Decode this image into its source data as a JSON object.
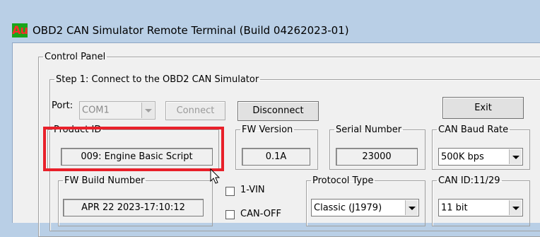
{
  "window": {
    "icon_text": "Au",
    "title": "OBD2 CAN Simulator Remote Terminal (Build 04262023-01)"
  },
  "control_panel": {
    "legend": "Control Panel",
    "step1": {
      "legend": "Step 1: Connect to the OBD2 CAN Simulator",
      "port_label": "Port:",
      "port_value": "COM1",
      "connect_label": "Connect",
      "disconnect_label": "Disconnect",
      "exit_label": "Exit"
    },
    "product_id": {
      "legend": "Product ID",
      "value": "009: Engine Basic Script"
    },
    "fw_version": {
      "legend": "FW Version",
      "value": "0.1A"
    },
    "serial_number": {
      "legend": "Serial Number",
      "value": "23000"
    },
    "can_baud_rate": {
      "legend": "CAN Baud Rate",
      "value": "500K bps"
    },
    "fw_build_number": {
      "legend": "FW Build Number",
      "value": "APR 22 2023-17:10:12"
    },
    "checkboxes": {
      "vin_label": "1-VIN",
      "can_off_label": "CAN-OFF"
    },
    "protocol_type": {
      "legend": "Protocol Type",
      "value": "Classic (J1979)"
    },
    "can_id": {
      "legend": "CAN ID:11/29",
      "value": "11 bit"
    }
  },
  "colors": {
    "highlight": "#e8202a",
    "titlebar": "#b9cfe6",
    "icon_bg": "#1aa51a",
    "icon_fg": "#ff2b2b"
  },
  "icons": {
    "cursor": "pointer-cursor-icon",
    "dropdown": "chevron-down-icon"
  }
}
